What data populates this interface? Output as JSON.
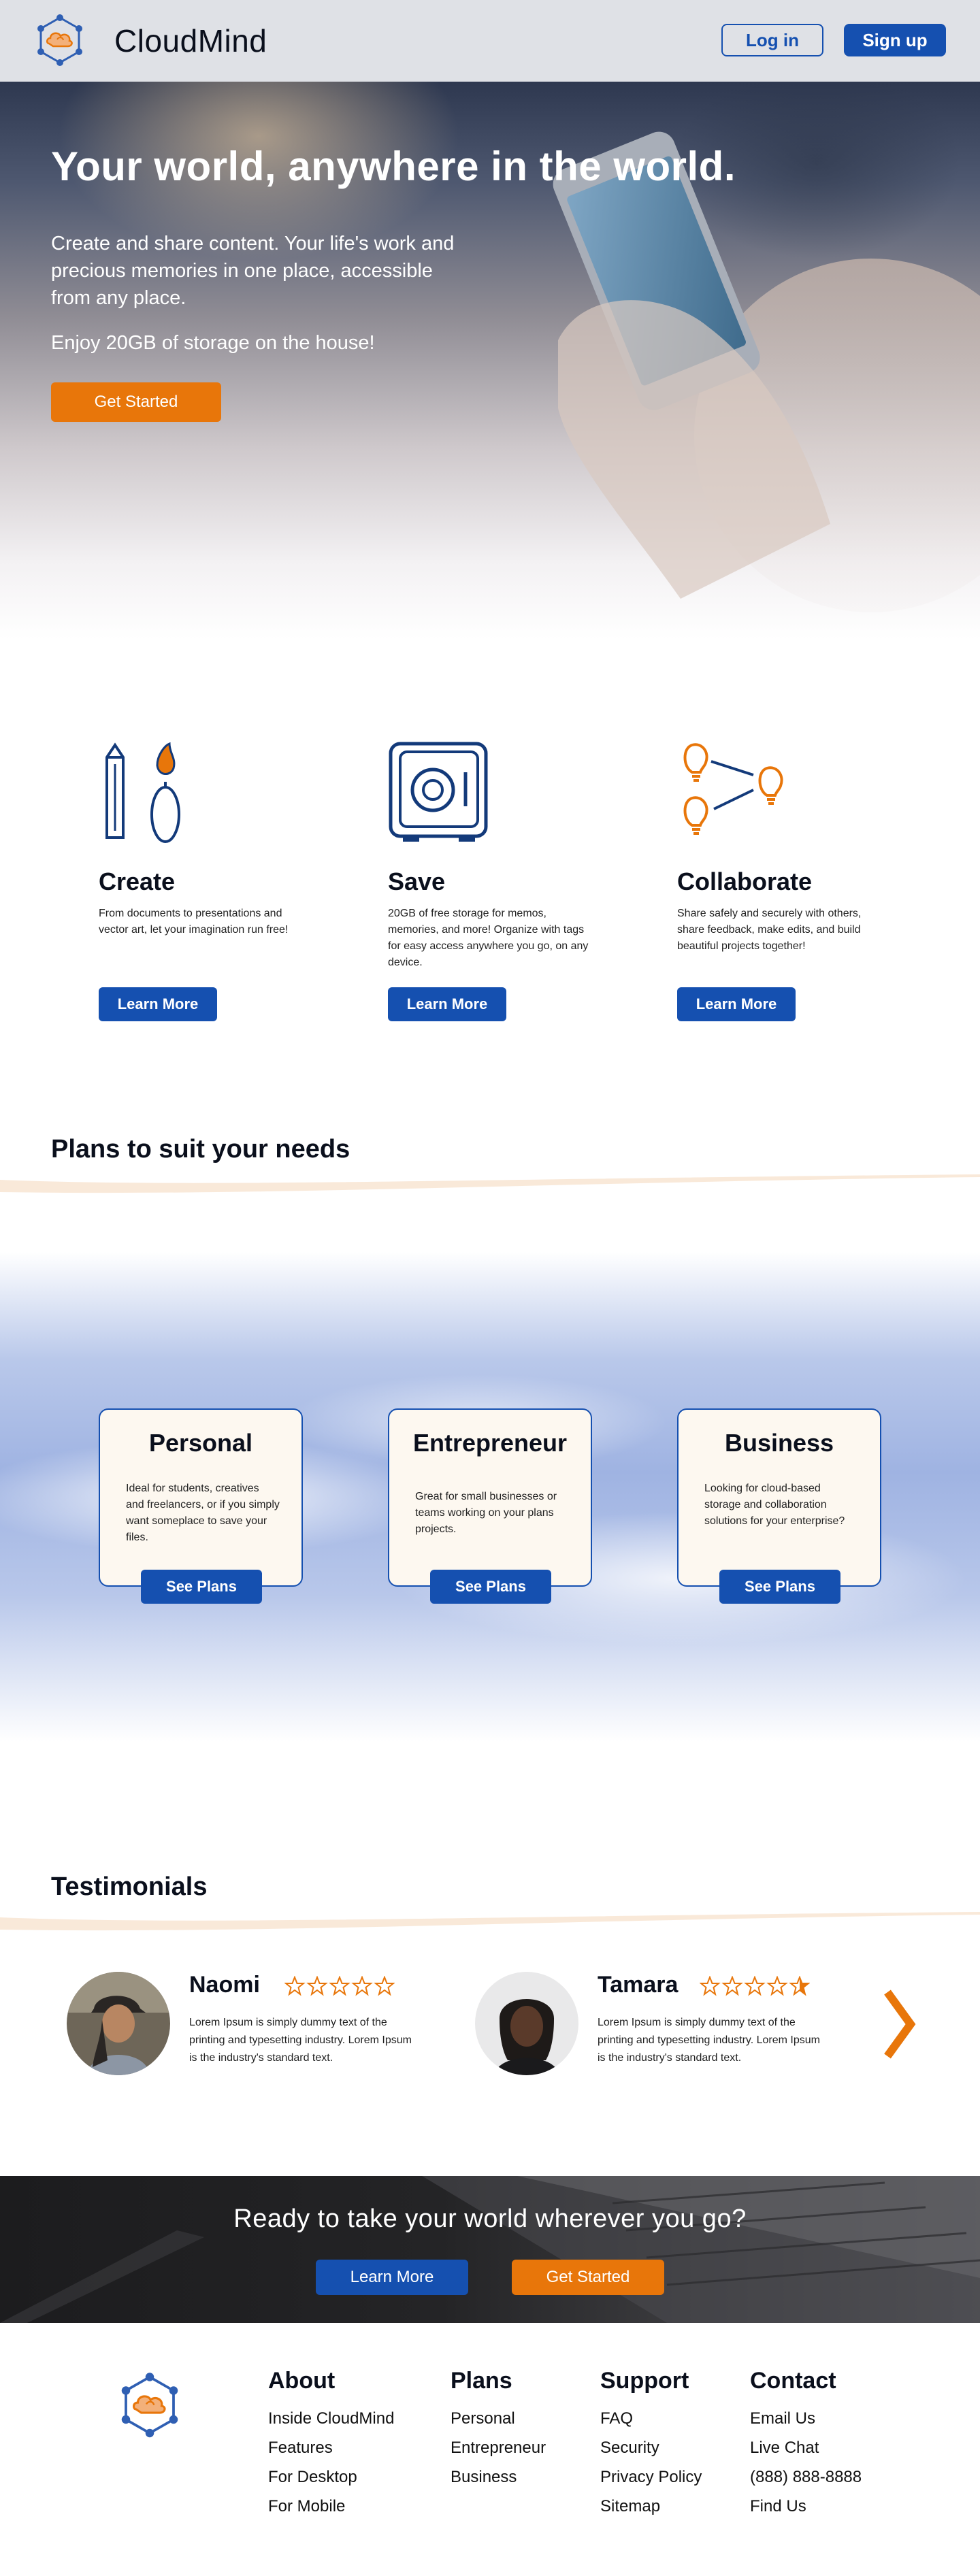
{
  "header": {
    "brand": "CloudMind",
    "login_label": "Log in",
    "signup_label": "Sign up"
  },
  "hero": {
    "title": "Your world, anywhere in the world.",
    "text": "Create and share content. Your life's work and precious memories in one place, accessible from any place.",
    "text2": "Enjoy 20GB of storage on the house!",
    "cta_label": "Get Started"
  },
  "features": [
    {
      "icon": "pencil-brush-icon",
      "title": "Create",
      "text": "From documents to presentations and vector art, let your imagination run free!",
      "button": "Learn More"
    },
    {
      "icon": "safe-icon",
      "title": "Save",
      "text": "20GB of free storage for memos, memories, and more! Organize with tags for easy access anywhere you go, on any device.",
      "button": "Learn More"
    },
    {
      "icon": "lightbulb-network-icon",
      "title": "Collaborate",
      "text": "Share safely and securely with others, share feedback, make edits, and build beautiful projects together!",
      "button": "Learn More"
    }
  ],
  "plans": {
    "title": "Plans to suit your needs",
    "items": [
      {
        "title": "Personal",
        "text": "Ideal for students, creatives and freelancers, or if you simply want someplace to save your files.",
        "button": "See Plans"
      },
      {
        "title": "Entrepreneur",
        "text": "Great for small businesses or teams working on your plans projects.",
        "button": "See Plans"
      },
      {
        "title": "Business",
        "text": "Looking for cloud-based storage and collaboration solutions for your enterprise?",
        "button": "See Plans"
      }
    ]
  },
  "testimonials": {
    "title": "Testimonials",
    "items": [
      {
        "name": "Naomi",
        "rating": 5,
        "text": "Lorem Ipsum is simply dummy text of the printing and typesetting industry. Lorem Ipsum is the industry's standard text."
      },
      {
        "name": "Tamara",
        "rating": 4.5,
        "text": "Lorem Ipsum is simply dummy text of the printing and typesetting industry. Lorem Ipsum is the industry's standard text."
      }
    ]
  },
  "cta": {
    "title": "Ready to take your world wherever you go?",
    "learn_label": "Learn More",
    "start_label": "Get Started"
  },
  "footer": {
    "columns": [
      {
        "title": "About",
        "links": [
          "Inside CloudMind",
          "Features",
          "For Desktop",
          "For Mobile"
        ]
      },
      {
        "title": "Plans",
        "links": [
          "Personal",
          "Entrepreneur",
          "Business"
        ]
      },
      {
        "title": "Support",
        "links": [
          "FAQ",
          "Security",
          "Privacy Policy",
          "Sitemap"
        ]
      },
      {
        "title": "Contact",
        "links": [
          "Email Us",
          "Live Chat",
          "(888) 888-8888",
          "Find Us"
        ]
      }
    ]
  },
  "colors": {
    "primary_blue": "#1550b0",
    "accent_orange": "#e8760a",
    "header_bg": "#dfe1e6",
    "card_bg": "#fdf8f0"
  }
}
